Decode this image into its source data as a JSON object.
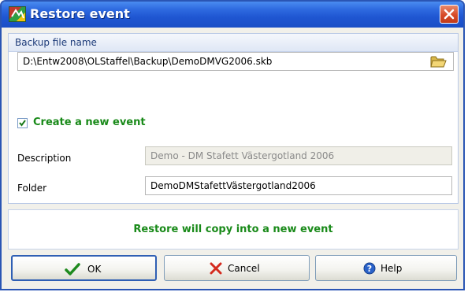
{
  "window": {
    "title": "Restore event",
    "close_icon": "close-icon"
  },
  "backup": {
    "header": "Backup file name",
    "path": "D:\\Entw2008\\OLStaffel\\Backup\\DemoDMVG2006.skb"
  },
  "options": {
    "create_new_event_label": "Create a new event",
    "create_new_event_checked": true
  },
  "form": {
    "description_label": "Description",
    "description_value": "Demo - DM Stafett Västergotland 2006",
    "folder_label": "Folder",
    "folder_value": "DemoDMStafettVästergotland2006"
  },
  "info": {
    "message": "Restore will copy into a new event"
  },
  "buttons": {
    "ok": "OK",
    "cancel": "Cancel",
    "help": "Help"
  },
  "colors": {
    "title_bar": "#1f56d2",
    "accent_green": "#198a19"
  }
}
